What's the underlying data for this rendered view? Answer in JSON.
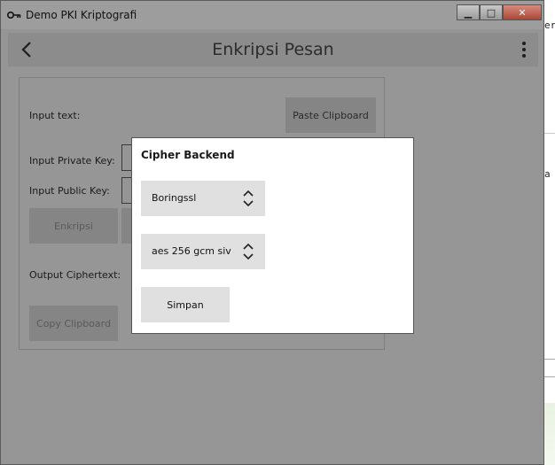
{
  "window": {
    "title": "Demo PKI Kriptografi",
    "minimize_label": "▁",
    "maximize_label": "□",
    "close_label": "✕"
  },
  "header": {
    "title": "Enkripsi Pesan",
    "back_icon": "chevron-left-icon",
    "menu_icon": "more-vertical-icon"
  },
  "form": {
    "input_text_label": "Input text:",
    "paste_button": "Paste Clipboard",
    "private_key_label": "Input Private Key:",
    "public_key_label": "Input Public Key:",
    "encrypt_button": "Enkripsi",
    "output_label": "Output Ciphertext:",
    "copy_button": "Copy Clipboard"
  },
  "dialog": {
    "title": "Cipher Backend",
    "backend_value": "Boringssl",
    "cipher_value": "aes 256 gcm siv",
    "save_button": "Simpan"
  },
  "background": {
    "text1": "er",
    "text2": "a"
  }
}
